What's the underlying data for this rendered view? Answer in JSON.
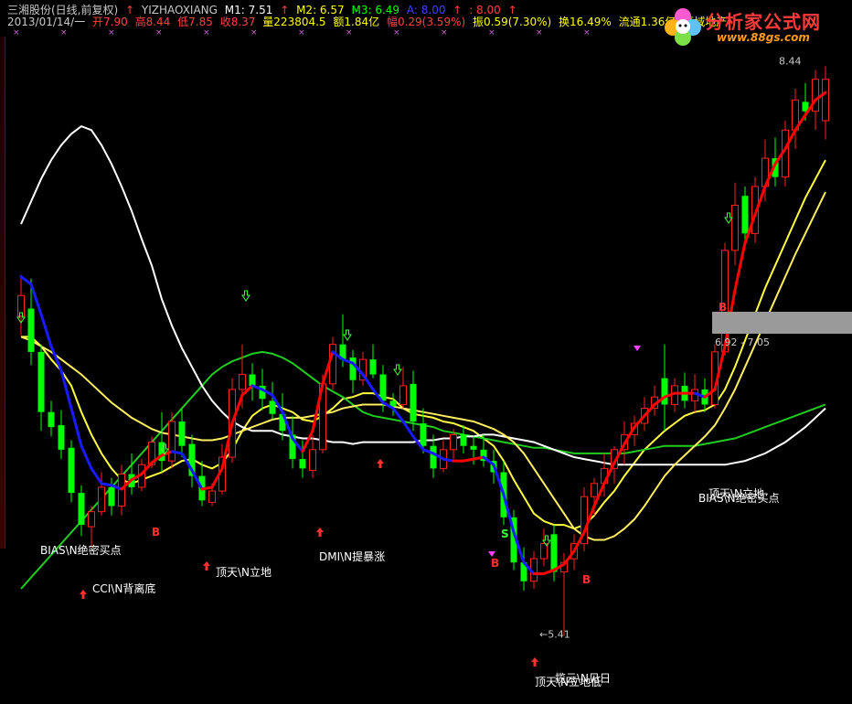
{
  "header": {
    "stock_name": "三湘股份(日线,前复权)",
    "indicator_name": "YIZHAOXIANG",
    "m1": "M1: 7.51",
    "m2": "M2: 6.57",
    "m3": "M3: 6.49",
    "a": "A: 8.00",
    "b": ": 8.00",
    "date": "2013/01/14/一",
    "open": "开7.90",
    "high": "高8.44",
    "low": "低7.85",
    "close": "收8.37",
    "volume": "量223804.5",
    "amount": "额1.84亿",
    "change": "幅0.29(3.59%)",
    "amplitude": "振0.59(7.30%)",
    "turnover": "换16.49%",
    "float_cap": "流通1.36亿",
    "sector": "区域地产"
  },
  "watermark": {
    "title": "分析家公式网",
    "url": "www.88gs.com"
  },
  "colors": {
    "background": "#000000",
    "up": "#ff2020",
    "down": "#00ff00",
    "ma_white": "#ffffff",
    "ma_yellow": "#ffff40",
    "ma_green": "#20cc20",
    "trend_up": "#ff0000",
    "trend_down": "#1a1aff",
    "header_white": "#c8c8c8",
    "header_red": "#ff4040",
    "header_green": "#00ff00",
    "header_yellow": "#ffff00",
    "header_blue": "#4040ff",
    "header_magenta": "#ff40ff"
  },
  "annotations": {
    "price_high": "8.44",
    "price_low": "5.41",
    "zone_label": "6.92 - 7.05",
    "signals": [
      "BIAS\\N绝密买点",
      "CCI\\N背离底",
      "顶天\\N立地",
      "DMI\\N提暴涨",
      "顶天\\N立地",
      "BIAS\\N绝密买点",
      "揽云\\N见日",
      "顶天\\N立地低"
    ],
    "buy_letter": "B",
    "sell_letter": "S"
  },
  "chart_data": {
    "type": "candlestick",
    "price_range": [
      5.3,
      8.5
    ],
    "candles": [
      [
        7.11,
        7.33,
        7.01,
        7.22
      ],
      [
        7.15,
        7.31,
        6.85,
        6.92
      ],
      [
        6.92,
        6.96,
        6.5,
        6.6
      ],
      [
        6.6,
        6.66,
        6.47,
        6.52
      ],
      [
        6.53,
        6.61,
        6.35,
        6.4
      ],
      [
        6.41,
        6.45,
        6.12,
        6.17
      ],
      [
        6.17,
        6.21,
        5.94,
        6.0
      ],
      [
        5.99,
        6.1,
        5.88,
        6.07
      ],
      [
        6.07,
        6.28,
        6.05,
        6.2
      ],
      [
        6.2,
        6.25,
        6.05,
        6.1
      ],
      [
        6.1,
        6.32,
        6.05,
        6.27
      ],
      [
        6.27,
        6.38,
        6.16,
        6.2
      ],
      [
        6.2,
        6.35,
        6.18,
        6.32
      ],
      [
        6.32,
        6.47,
        6.3,
        6.44
      ],
      [
        6.44,
        6.6,
        6.28,
        6.34
      ],
      [
        6.34,
        6.6,
        6.3,
        6.55
      ],
      [
        6.55,
        6.62,
        6.36,
        6.42
      ],
      [
        6.43,
        6.48,
        6.2,
        6.26
      ],
      [
        6.26,
        6.34,
        6.1,
        6.13
      ],
      [
        6.12,
        6.22,
        6.1,
        6.18
      ],
      [
        6.18,
        6.43,
        6.16,
        6.36
      ],
      [
        6.36,
        6.78,
        6.33,
        6.72
      ],
      [
        6.72,
        6.96,
        6.62,
        6.8
      ],
      [
        6.8,
        6.86,
        6.66,
        6.74
      ],
      [
        6.74,
        6.83,
        6.61,
        6.67
      ],
      [
        6.66,
        6.76,
        6.56,
        6.59
      ],
      [
        6.59,
        6.7,
        6.45,
        6.5
      ],
      [
        6.48,
        6.58,
        6.3,
        6.35
      ],
      [
        6.35,
        6.45,
        6.25,
        6.3
      ],
      [
        6.29,
        6.48,
        6.25,
        6.4
      ],
      [
        6.4,
        6.8,
        6.38,
        6.75
      ],
      [
        6.75,
        7.0,
        6.72,
        6.96
      ],
      [
        6.96,
        7.12,
        6.84,
        6.88
      ],
      [
        6.89,
        6.93,
        6.7,
        6.77
      ],
      [
        6.77,
        6.92,
        6.74,
        6.88
      ],
      [
        6.88,
        6.96,
        6.78,
        6.8
      ],
      [
        6.8,
        6.85,
        6.6,
        6.66
      ],
      [
        6.66,
        6.7,
        6.58,
        6.63
      ],
      [
        6.64,
        6.84,
        6.62,
        6.74
      ],
      [
        6.75,
        6.82,
        6.5,
        6.55
      ],
      [
        6.54,
        6.62,
        6.38,
        6.42
      ],
      [
        6.42,
        6.48,
        6.25,
        6.3
      ],
      [
        6.3,
        6.45,
        6.28,
        6.4
      ],
      [
        6.4,
        6.51,
        6.35,
        6.48
      ],
      [
        6.48,
        6.53,
        6.38,
        6.42
      ],
      [
        6.42,
        6.47,
        6.32,
        6.4
      ],
      [
        6.4,
        6.48,
        6.31,
        6.34
      ],
      [
        6.34,
        6.4,
        6.22,
        6.28
      ],
      [
        6.28,
        6.34,
        6.0,
        6.04
      ],
      [
        6.04,
        6.08,
        5.76,
        5.8
      ],
      [
        5.8,
        5.88,
        5.65,
        5.7
      ],
      [
        5.7,
        5.86,
        5.66,
        5.82
      ],
      [
        5.82,
        5.98,
        5.78,
        5.9
      ],
      [
        5.95,
        6.0,
        5.7,
        5.75
      ],
      [
        5.75,
        5.85,
        5.41,
        5.8
      ],
      [
        5.82,
        5.95,
        5.76,
        5.9
      ],
      [
        5.9,
        6.2,
        5.86,
        6.15
      ],
      [
        6.15,
        6.25,
        6.05,
        6.22
      ],
      [
        6.22,
        6.38,
        6.15,
        6.3
      ],
      [
        6.3,
        6.42,
        6.22,
        6.4
      ],
      [
        6.4,
        6.55,
        6.32,
        6.48
      ],
      [
        6.48,
        6.58,
        6.42,
        6.54
      ],
      [
        6.54,
        6.68,
        6.5,
        6.62
      ],
      [
        6.62,
        6.74,
        6.58,
        6.68
      ],
      [
        6.78,
        6.96,
        6.5,
        6.64
      ],
      [
        6.64,
        6.78,
        6.6,
        6.74
      ],
      [
        6.74,
        6.81,
        6.62,
        6.66
      ],
      [
        6.66,
        6.8,
        6.6,
        6.72
      ],
      [
        6.72,
        6.78,
        6.6,
        6.64
      ],
      [
        6.64,
        6.96,
        6.62,
        6.92
      ],
      [
        6.92,
        7.5,
        6.9,
        7.46
      ],
      [
        7.46,
        7.82,
        7.38,
        7.7
      ],
      [
        7.75,
        7.8,
        7.5,
        7.55
      ],
      [
        7.55,
        7.85,
        7.5,
        7.8
      ],
      [
        7.8,
        8.05,
        7.72,
        7.95
      ],
      [
        7.95,
        8.06,
        7.8,
        7.85
      ],
      [
        7.85,
        8.15,
        7.8,
        8.1
      ],
      [
        8.1,
        8.32,
        8.0,
        8.26
      ],
      [
        8.25,
        8.35,
        8.15,
        8.2
      ],
      [
        8.2,
        8.42,
        8.1,
        8.37
      ],
      [
        8.15,
        8.44,
        8.05,
        8.37
      ]
    ],
    "series": [
      {
        "name": "M1",
        "values": [
          7.32,
          7.28,
          7.12,
          6.95,
          6.82,
          6.62,
          6.42,
          6.3,
          6.22,
          6.21,
          6.19,
          6.24,
          6.27,
          6.33,
          6.37,
          6.39,
          6.38,
          6.29,
          6.19,
          6.2,
          6.3,
          6.54,
          6.69,
          6.74,
          6.72,
          6.69,
          6.6,
          6.46,
          6.39,
          6.5,
          6.75,
          6.92,
          6.88,
          6.86,
          6.8,
          6.72,
          6.65,
          6.62,
          6.55,
          6.47,
          6.4,
          6.38,
          6.35,
          6.34,
          6.34,
          6.35,
          6.36,
          6.32,
          6.16,
          5.96,
          5.8,
          5.74,
          5.74,
          5.76,
          5.79,
          5.86,
          5.96,
          6.1,
          6.22,
          6.33,
          6.43,
          6.52,
          6.58,
          6.64,
          6.68,
          6.7,
          6.7,
          6.7,
          6.68,
          6.72,
          6.95,
          7.25,
          7.5,
          7.65,
          7.8,
          7.92,
          8.0,
          8.1,
          8.18,
          8.26,
          8.3
        ]
      },
      {
        "name": "M2",
        "values": [
          7.0,
          7.0,
          6.95,
          6.88,
          6.82,
          6.74,
          6.6,
          6.48,
          6.38,
          6.3,
          6.24,
          6.22,
          6.24,
          6.26,
          6.28,
          6.31,
          6.34,
          6.35,
          6.32,
          6.3,
          6.33,
          6.4,
          6.5,
          6.58,
          6.62,
          6.64,
          6.62,
          6.6,
          6.56,
          6.55,
          6.58,
          6.62,
          6.67,
          6.68,
          6.7,
          6.7,
          6.68,
          6.67,
          6.62,
          6.59,
          6.58,
          6.57,
          6.55,
          6.54,
          6.52,
          6.5,
          6.46,
          6.42,
          6.34,
          6.24,
          6.15,
          6.06,
          6.02,
          6.0,
          6.0,
          5.98,
          6.0,
          6.05,
          6.12,
          6.18,
          6.26,
          6.33,
          6.4,
          6.45,
          6.5,
          6.54,
          6.58,
          6.6,
          6.61,
          6.64,
          6.72,
          6.84,
          6.98,
          7.12,
          7.26,
          7.38,
          7.5,
          7.62,
          7.74,
          7.84,
          7.94
        ]
      },
      {
        "name": "M3",
        "values": [
          5.66,
          5.72,
          5.78,
          5.84,
          5.9,
          5.96,
          6.02,
          6.08,
          6.14,
          6.2,
          6.26,
          6.32,
          6.38,
          6.44,
          6.5,
          6.56,
          6.62,
          6.68,
          6.74,
          6.8,
          6.84,
          6.87,
          6.89,
          6.91,
          6.92,
          6.91,
          6.89,
          6.86,
          6.82,
          6.78,
          6.74,
          6.71,
          6.68,
          6.64,
          6.6,
          6.58,
          6.57,
          6.56,
          6.55,
          6.54,
          6.53,
          6.52,
          6.5,
          6.49,
          6.48,
          6.47,
          6.46,
          6.45,
          6.44,
          6.43,
          6.42,
          6.41,
          6.41,
          6.4,
          6.39,
          6.38,
          6.38,
          6.38,
          6.38,
          6.38,
          6.38,
          6.39,
          6.4,
          6.41,
          6.42,
          6.42,
          6.42,
          6.42,
          6.43,
          6.44,
          6.45,
          6.46,
          6.48,
          6.5,
          6.52,
          6.54,
          6.56,
          6.58,
          6.6,
          6.62,
          6.64
        ]
      },
      {
        "name": "A",
        "values": [
          7.6,
          7.72,
          7.84,
          7.94,
          8.02,
          8.08,
          8.12,
          8.1,
          8.02,
          7.92,
          7.8,
          7.67,
          7.52,
          7.38,
          7.2,
          7.06,
          6.94,
          6.84,
          6.74,
          6.66,
          6.6,
          6.55,
          6.52,
          6.5,
          6.5,
          6.5,
          6.48,
          6.47,
          6.46,
          6.46,
          6.45,
          6.44,
          6.44,
          6.43,
          6.44,
          6.44,
          6.44,
          6.44,
          6.44,
          6.44,
          6.45,
          6.45,
          6.46,
          6.46,
          6.47,
          6.47,
          6.48,
          6.48,
          6.47,
          6.46,
          6.45,
          6.44,
          6.42,
          6.4,
          6.38,
          6.36,
          6.35,
          6.34,
          6.33,
          6.32,
          6.32,
          6.32,
          6.32,
          6.32,
          6.32,
          6.32,
          6.32,
          6.32,
          6.32,
          6.32,
          6.32,
          6.33,
          6.34,
          6.36,
          6.38,
          6.41,
          6.44,
          6.48,
          6.52,
          6.57,
          6.62
        ]
      },
      {
        "name": "B",
        "values": [
          7.0,
          6.98,
          6.95,
          6.92,
          6.88,
          6.84,
          6.8,
          6.75,
          6.7,
          6.65,
          6.61,
          6.57,
          6.54,
          6.51,
          6.49,
          6.48,
          6.47,
          6.46,
          6.45,
          6.45,
          6.46,
          6.48,
          6.5,
          6.52,
          6.54,
          6.56,
          6.57,
          6.57,
          6.57,
          6.58,
          6.59,
          6.6,
          6.62,
          6.63,
          6.64,
          6.64,
          6.64,
          6.63,
          6.62,
          6.61,
          6.6,
          6.59,
          6.58,
          6.57,
          6.56,
          6.55,
          6.53,
          6.51,
          6.48,
          6.44,
          6.38,
          6.3,
          6.22,
          6.14,
          6.06,
          5.98,
          5.94,
          5.92,
          5.92,
          5.94,
          5.98,
          6.03,
          6.1,
          6.18,
          6.26,
          6.32,
          6.37,
          6.42,
          6.47,
          6.53,
          6.62,
          6.72,
          6.84,
          6.96,
          7.08,
          7.2,
          7.32,
          7.44,
          7.55,
          7.66,
          7.77
        ]
      }
    ]
  }
}
